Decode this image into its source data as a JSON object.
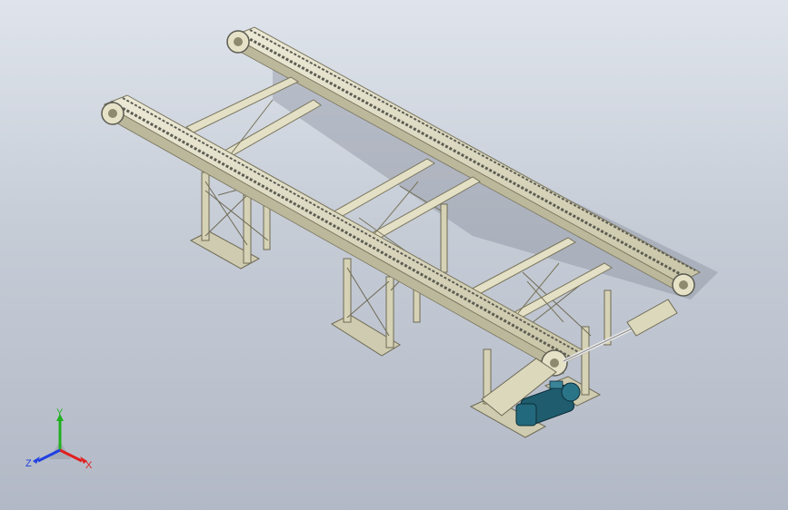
{
  "viewport": {
    "background_top": "#dfe4ec",
    "background_bottom": "#b2b9c6"
  },
  "model": {
    "frame_color": "#d8d4b8",
    "frame_dark": "#8e8a70",
    "chain_color": "#6f6f66",
    "motor_color": "#1e5c6e"
  },
  "triad": {
    "x_label": "X",
    "y_label": "Y",
    "z_label": "Z",
    "x_color": "#e02020",
    "y_color": "#20b020",
    "z_color": "#2040e0"
  }
}
